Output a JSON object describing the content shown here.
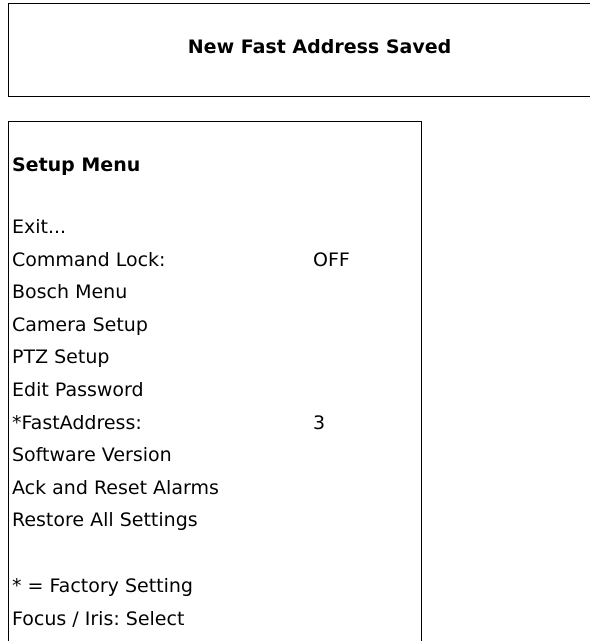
{
  "notice": {
    "title": "New Fast Address Saved"
  },
  "menu": {
    "title": "Setup Menu",
    "items": [
      {
        "label": "Exit...",
        "value": ""
      },
      {
        "label": "Command Lock:",
        "value": "OFF"
      },
      {
        "label": "Bosch Menu",
        "value": ""
      },
      {
        "label": "Camera Setup",
        "value": ""
      },
      {
        "label": "PTZ Setup",
        "value": ""
      },
      {
        "label": "Edit Password",
        "value": ""
      },
      {
        "label": "*FastAddress:",
        "value": "3"
      },
      {
        "label": "Software Version",
        "value": ""
      },
      {
        "label": "Ack and Reset Alarms",
        "value": ""
      },
      {
        "label": "Restore All Settings",
        "value": ""
      }
    ],
    "footer": {
      "factory_note": "* = Factory Setting",
      "hint": "Focus / Iris: Select"
    }
  }
}
